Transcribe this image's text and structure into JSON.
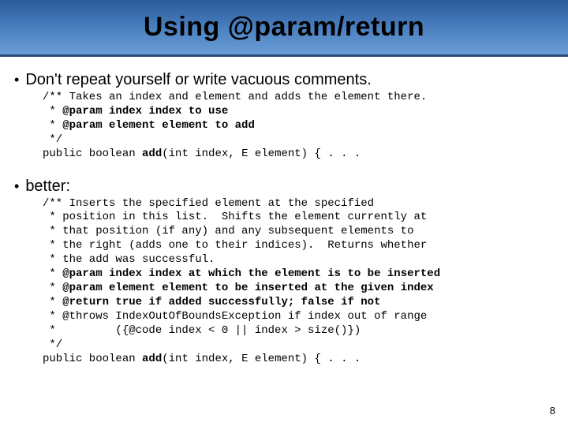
{
  "title": "Using @param/return",
  "bullets": {
    "first": "Don't repeat yourself or write vacuous comments.",
    "second": "better:"
  },
  "code": {
    "bad": {
      "l1": "/** Takes an index and element and adds the element there.",
      "l2p": " * ",
      "l2b": "@param index index to use",
      "l3p": " * ",
      "l3b": "@param element element to add",
      "l4": " */",
      "l5a": "public boolean ",
      "l5b": "add",
      "l5c": "(int index, E element) { . . ."
    },
    "good": {
      "l1": "/** Inserts the specified element at the specified",
      "l2": " * position in this list.  Shifts the element currently at",
      "l3": " * that position (if any) and any subsequent elements to",
      "l4": " * the right (adds one to their indices).  Returns whether",
      "l5": " * the add was successful.",
      "l6p": " * ",
      "l6b": "@param index index at which the element is to be inserted",
      "l7p": " * ",
      "l7b": "@param element element to be inserted at the given index",
      "l8p": " * ",
      "l8b": "@return true if added successfully; false if not",
      "l9": " * @throws IndexOutOfBoundsException if index out of range",
      "l10": " *         ({@code index < 0 || index > size()})",
      "l11": " */",
      "l12a": "public boolean ",
      "l12b": "add",
      "l12c": "(int index, E element) { . . ."
    }
  },
  "page_number": "8"
}
